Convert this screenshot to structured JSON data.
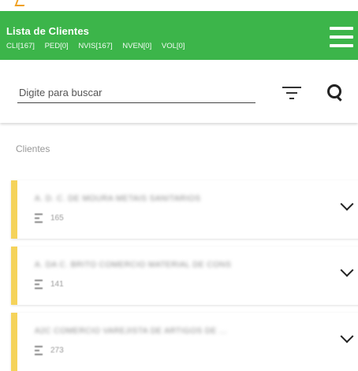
{
  "header": {
    "title": "Lista de Clientes",
    "counts": [
      {
        "label": "CLI[167]"
      },
      {
        "label": "PED[0]"
      },
      {
        "label": "NVIS[167]"
      },
      {
        "label": "NVEN[0]"
      },
      {
        "label": "VOL[0]"
      }
    ],
    "menu_icon": "hamburger-menu-icon"
  },
  "search": {
    "placeholder": "Digite para buscar",
    "value": "",
    "filter_icon": "filter-icon",
    "search_icon": "search-icon"
  },
  "section": {
    "label": "Clientes"
  },
  "clients": [
    {
      "name": "A. D. C. DE MOURA METAIS SANITARIOS",
      "code": "165"
    },
    {
      "name": "A. DA C. BRITO COMERCIO MATERIAL DE CONS",
      "code": "141"
    },
    {
      "name": "A2C COMERCIO VAREJISTA DE ARTIGOS DE ...",
      "code": "273"
    }
  ],
  "colors": {
    "appbar": "#3cb54a",
    "card_accent": "#f5d35a"
  }
}
